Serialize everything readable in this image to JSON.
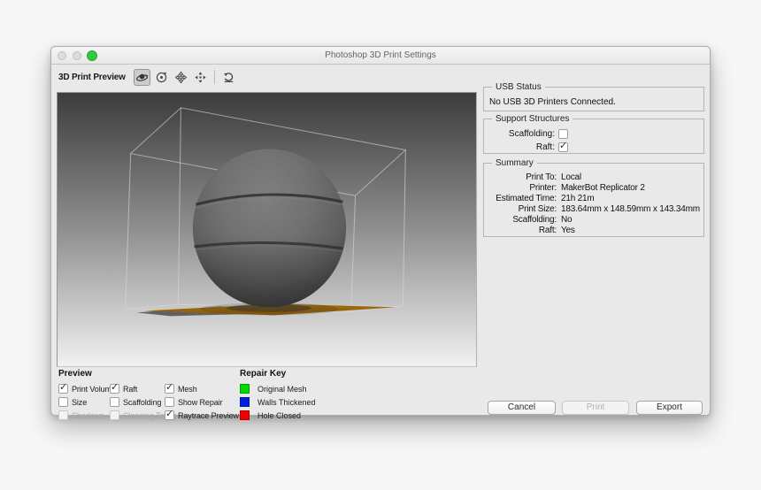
{
  "window": {
    "title": "Photoshop 3D Print Settings"
  },
  "toolbar": {
    "label": "3D Print Preview",
    "tools": [
      {
        "name": "orbit-3d-camera",
        "selected": true
      },
      {
        "name": "roll-3d-camera",
        "selected": false
      },
      {
        "name": "pan-3d-camera",
        "selected": false
      },
      {
        "name": "slide-3d-camera",
        "selected": false
      },
      {
        "name": "reset-camera",
        "selected": false
      }
    ]
  },
  "usb_status": {
    "legend": "USB Status",
    "message": "No USB 3D Printers Connected."
  },
  "support_structures": {
    "legend": "Support Structures",
    "scaffolding_label": "Scaffolding:",
    "scaffolding_checked": false,
    "raft_label": "Raft:",
    "raft_checked": true
  },
  "summary": {
    "legend": "Summary",
    "rows": [
      {
        "label": "Print To:",
        "value": "Local"
      },
      {
        "label": "Printer:",
        "value": "MakerBot Replicator 2"
      },
      {
        "label": "Estimated Time:",
        "value": "21h 21m"
      },
      {
        "label": "Print Size:",
        "value": "183.64mm x 148.59mm x 143.34mm"
      },
      {
        "label": "Scaffolding:",
        "value": "No"
      },
      {
        "label": "Raft:",
        "value": "Yes"
      }
    ]
  },
  "preview_options": {
    "title": "Preview",
    "columns": [
      {
        "items": [
          {
            "label": "Print Volume",
            "checked": true,
            "disabled": false
          },
          {
            "label": "Size",
            "checked": false,
            "disabled": false
          },
          {
            "label": "Shadows",
            "checked": false,
            "disabled": true
          }
        ]
      },
      {
        "items": [
          {
            "label": "Raft",
            "checked": true,
            "disabled": false
          },
          {
            "label": "Scaffolding",
            "checked": false,
            "disabled": false
          },
          {
            "label": "Cleaning Tower",
            "checked": false,
            "disabled": true
          }
        ]
      },
      {
        "items": [
          {
            "label": "Mesh",
            "checked": true,
            "disabled": false
          },
          {
            "label": "Show Repair",
            "checked": false,
            "disabled": false
          },
          {
            "label": "Raytrace Preview",
            "checked": true,
            "disabled": false
          }
        ]
      }
    ]
  },
  "repair_key": {
    "title": "Repair Key",
    "items": [
      {
        "label": "Original Mesh",
        "color": "#00d800"
      },
      {
        "label": "Walls Thickened",
        "color": "#0020e0"
      },
      {
        "label": "Hole Closed",
        "color": "#f00000"
      }
    ]
  },
  "action_buttons": {
    "cancel": "Cancel",
    "print": "Print",
    "print_disabled": true,
    "export": "Export"
  },
  "scene": {
    "model": "sphere with two horizontal seams",
    "raft_color": "#f2a216",
    "background": "gray gradient dark-top to light-bottom"
  }
}
